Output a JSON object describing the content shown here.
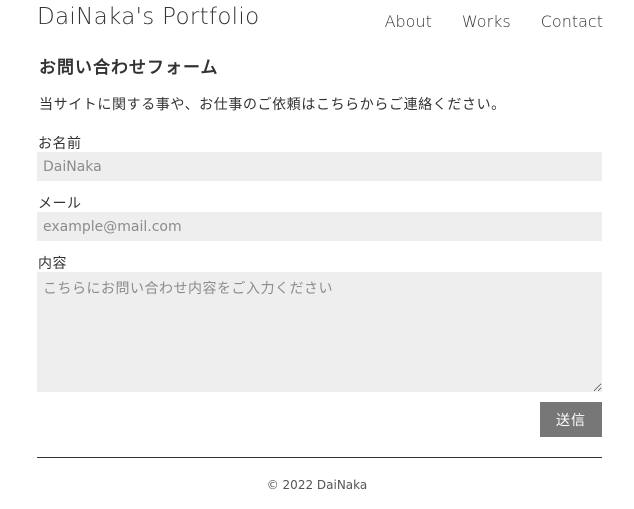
{
  "header": {
    "site_title": "DaiNaka's Portfolio",
    "nav": [
      {
        "label": "About"
      },
      {
        "label": "Works"
      },
      {
        "label": "Contact"
      }
    ]
  },
  "contact_form": {
    "title": "お問い合わせフォーム",
    "intro": "当サイトに関する事や、お仕事のご依頼はこちらからご連絡ください。",
    "name_field": {
      "label": "お名前",
      "placeholder": "DaiNaka"
    },
    "email_field": {
      "label": "メール",
      "placeholder": "example@mail.com"
    },
    "message_field": {
      "label": "内容",
      "placeholder": "こちらにお問い合わせ内容をご入力ください"
    },
    "submit_label": "送信"
  },
  "footer": {
    "copyright": "© 2022 DaiNaka"
  },
  "colors": {
    "input_background": "#eeeeee",
    "submit_button": "#777777",
    "text": "#333333"
  }
}
